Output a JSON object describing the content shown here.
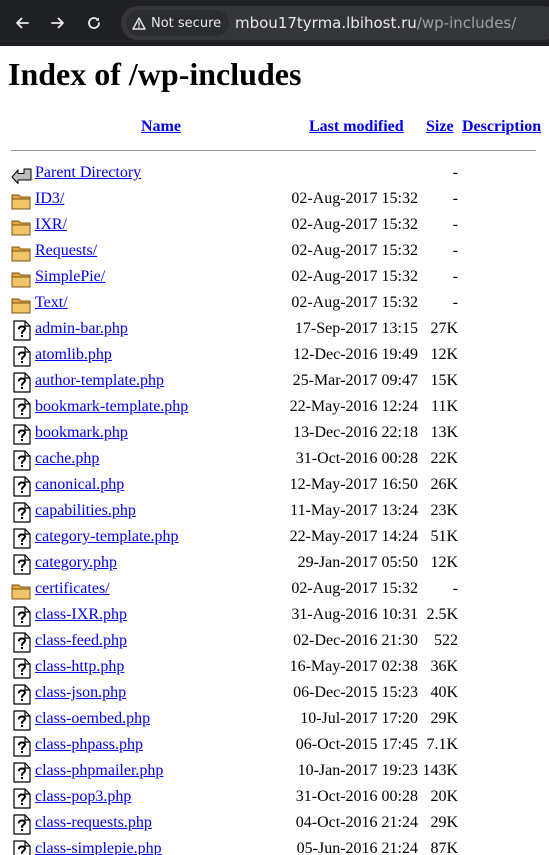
{
  "browser": {
    "security_chip": "Not secure",
    "url_host": "mbou17tyrma.lbihost.ru",
    "url_path": "/wp-includes/"
  },
  "page": {
    "title": "Index of /wp-includes",
    "columns": {
      "name": "Name",
      "last_modified": "Last modified",
      "size": "Size",
      "description": "Description"
    },
    "rows": [
      {
        "icon": "back-icon",
        "name": "Parent Directory",
        "date": "",
        "size": "-"
      },
      {
        "icon": "folder-icon",
        "name": "ID3/",
        "date": "02-Aug-2017 15:32",
        "size": "-"
      },
      {
        "icon": "folder-icon",
        "name": "IXR/",
        "date": "02-Aug-2017 15:32",
        "size": "-"
      },
      {
        "icon": "folder-icon",
        "name": "Requests/",
        "date": "02-Aug-2017 15:32",
        "size": "-"
      },
      {
        "icon": "folder-icon",
        "name": "SimplePie/",
        "date": "02-Aug-2017 15:32",
        "size": "-"
      },
      {
        "icon": "folder-icon",
        "name": "Text/",
        "date": "02-Aug-2017 15:32",
        "size": "-"
      },
      {
        "icon": "unknown-file-icon",
        "name": "admin-bar.php",
        "date": "17-Sep-2017 13:15",
        "size": "27K"
      },
      {
        "icon": "unknown-file-icon",
        "name": "atomlib.php",
        "date": "12-Dec-2016 19:49",
        "size": "12K"
      },
      {
        "icon": "unknown-file-icon",
        "name": "author-template.php",
        "date": "25-Mar-2017 09:47",
        "size": "15K"
      },
      {
        "icon": "unknown-file-icon",
        "name": "bookmark-template.php",
        "date": "22-May-2016 12:24",
        "size": "11K"
      },
      {
        "icon": "unknown-file-icon",
        "name": "bookmark.php",
        "date": "13-Dec-2016 22:18",
        "size": "13K"
      },
      {
        "icon": "unknown-file-icon",
        "name": "cache.php",
        "date": "31-Oct-2016 00:28",
        "size": "22K"
      },
      {
        "icon": "unknown-file-icon",
        "name": "canonical.php",
        "date": "12-May-2017 16:50",
        "size": "26K"
      },
      {
        "icon": "unknown-file-icon",
        "name": "capabilities.php",
        "date": "11-May-2017 13:24",
        "size": "23K"
      },
      {
        "icon": "unknown-file-icon",
        "name": "category-template.php",
        "date": "22-May-2017 14:24",
        "size": "51K"
      },
      {
        "icon": "unknown-file-icon",
        "name": "category.php",
        "date": "29-Jan-2017 05:50",
        "size": "12K"
      },
      {
        "icon": "folder-icon",
        "name": "certificates/",
        "date": "02-Aug-2017 15:32",
        "size": "-"
      },
      {
        "icon": "unknown-file-icon",
        "name": "class-IXR.php",
        "date": "31-Aug-2016 10:31",
        "size": "2.5K"
      },
      {
        "icon": "unknown-file-icon",
        "name": "class-feed.php",
        "date": "02-Dec-2016 21:30",
        "size": "522"
      },
      {
        "icon": "unknown-file-icon",
        "name": "class-http.php",
        "date": "16-May-2017 02:38",
        "size": "36K"
      },
      {
        "icon": "unknown-file-icon",
        "name": "class-json.php",
        "date": "06-Dec-2015 15:23",
        "size": "40K"
      },
      {
        "icon": "unknown-file-icon",
        "name": "class-oembed.php",
        "date": "10-Jul-2017 17:20",
        "size": "29K"
      },
      {
        "icon": "unknown-file-icon",
        "name": "class-phpass.php",
        "date": "06-Oct-2015 17:45",
        "size": "7.1K"
      },
      {
        "icon": "unknown-file-icon",
        "name": "class-phpmailer.php",
        "date": "10-Jan-2017 19:23",
        "size": "143K"
      },
      {
        "icon": "unknown-file-icon",
        "name": "class-pop3.php",
        "date": "31-Oct-2016 00:28",
        "size": "20K"
      },
      {
        "icon": "unknown-file-icon",
        "name": "class-requests.php",
        "date": "04-Oct-2016 21:24",
        "size": "29K"
      },
      {
        "icon": "unknown-file-icon",
        "name": "class-simplepie.php",
        "date": "05-Jun-2016 21:24",
        "size": "87K"
      }
    ]
  }
}
